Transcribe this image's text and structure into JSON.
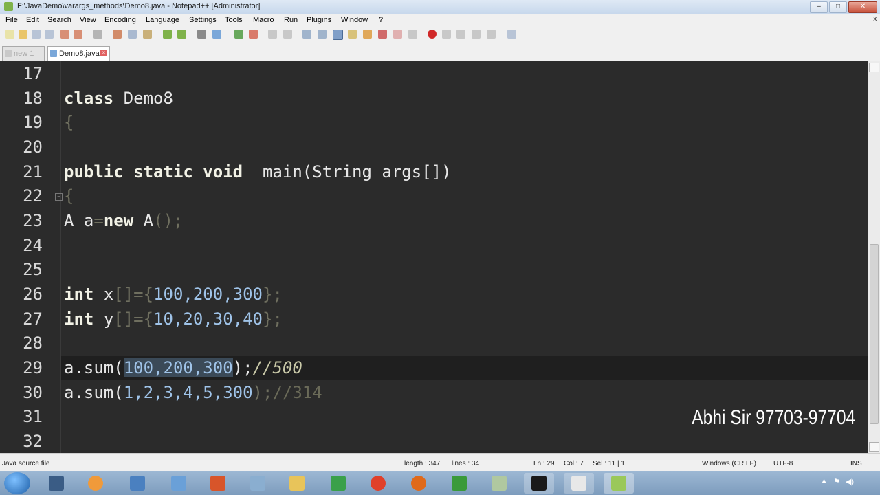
{
  "window": {
    "title": "F:\\JavaDemo\\varargs_methods\\Demo8.java - Notepad++ [Administrator]"
  },
  "menu": [
    "File",
    "Edit",
    "Search",
    "View",
    "Encoding",
    "Language",
    "Settings",
    "Tools",
    "Macro",
    "Run",
    "Plugins",
    "Window",
    "?"
  ],
  "tabs": [
    {
      "label": "new 1",
      "active": false
    },
    {
      "label": "Demo8.java",
      "active": true
    }
  ],
  "code": {
    "line_numbers": [
      "17",
      "18",
      "19",
      "20",
      "21",
      "22",
      "23",
      "24",
      "25",
      "26",
      "27",
      "28",
      "29",
      "30",
      "31",
      "32"
    ],
    "current_line": "29",
    "l18": {
      "kw": "class",
      "rest": "Demo8"
    },
    "l19": {
      "brace": "{"
    },
    "l21": {
      "kw": "public static void",
      "name": "main",
      "args": "(String args[])"
    },
    "l22": {
      "brace": "{"
    },
    "l23": {
      "a": "A a",
      "eq": "=",
      "kw": "new",
      "cls": "A",
      "tail": "();"
    },
    "l26": {
      "kw": "int",
      "var": "x",
      "br": "[]={",
      "nums": "100,200,300",
      "end": "};"
    },
    "l27": {
      "kw": "int",
      "var": "y",
      "br": "[]={",
      "nums": "10,20,30,40",
      "end": "};"
    },
    "l29": {
      "call": "a.sum(",
      "sel": "100,200,300",
      "close": ");",
      "comment": "//500"
    },
    "l30": {
      "call": "a.sum(",
      "nums": "1,2,3,4,5,300",
      "close": ");",
      "comment": "//314"
    }
  },
  "watermark": "Abhi Sir 97703-97704",
  "status": {
    "file_type": "Java source file",
    "length": "length : 347",
    "lines": "lines : 34",
    "ln": "Ln : 29",
    "col": "Col : 7",
    "sel": "Sel : 11 | 1",
    "eol": "Windows (CR LF)",
    "encoding": "UTF-8",
    "mode": "INS"
  },
  "taskbar_apps": [
    "calculator",
    "media-player",
    "computer",
    "network",
    "office",
    "folder-files",
    "explorer",
    "paint",
    "chrome",
    "firefox",
    "windows-logo",
    "edit-tool",
    "terminal",
    "notepad-window",
    "notepad-plus-plus"
  ]
}
